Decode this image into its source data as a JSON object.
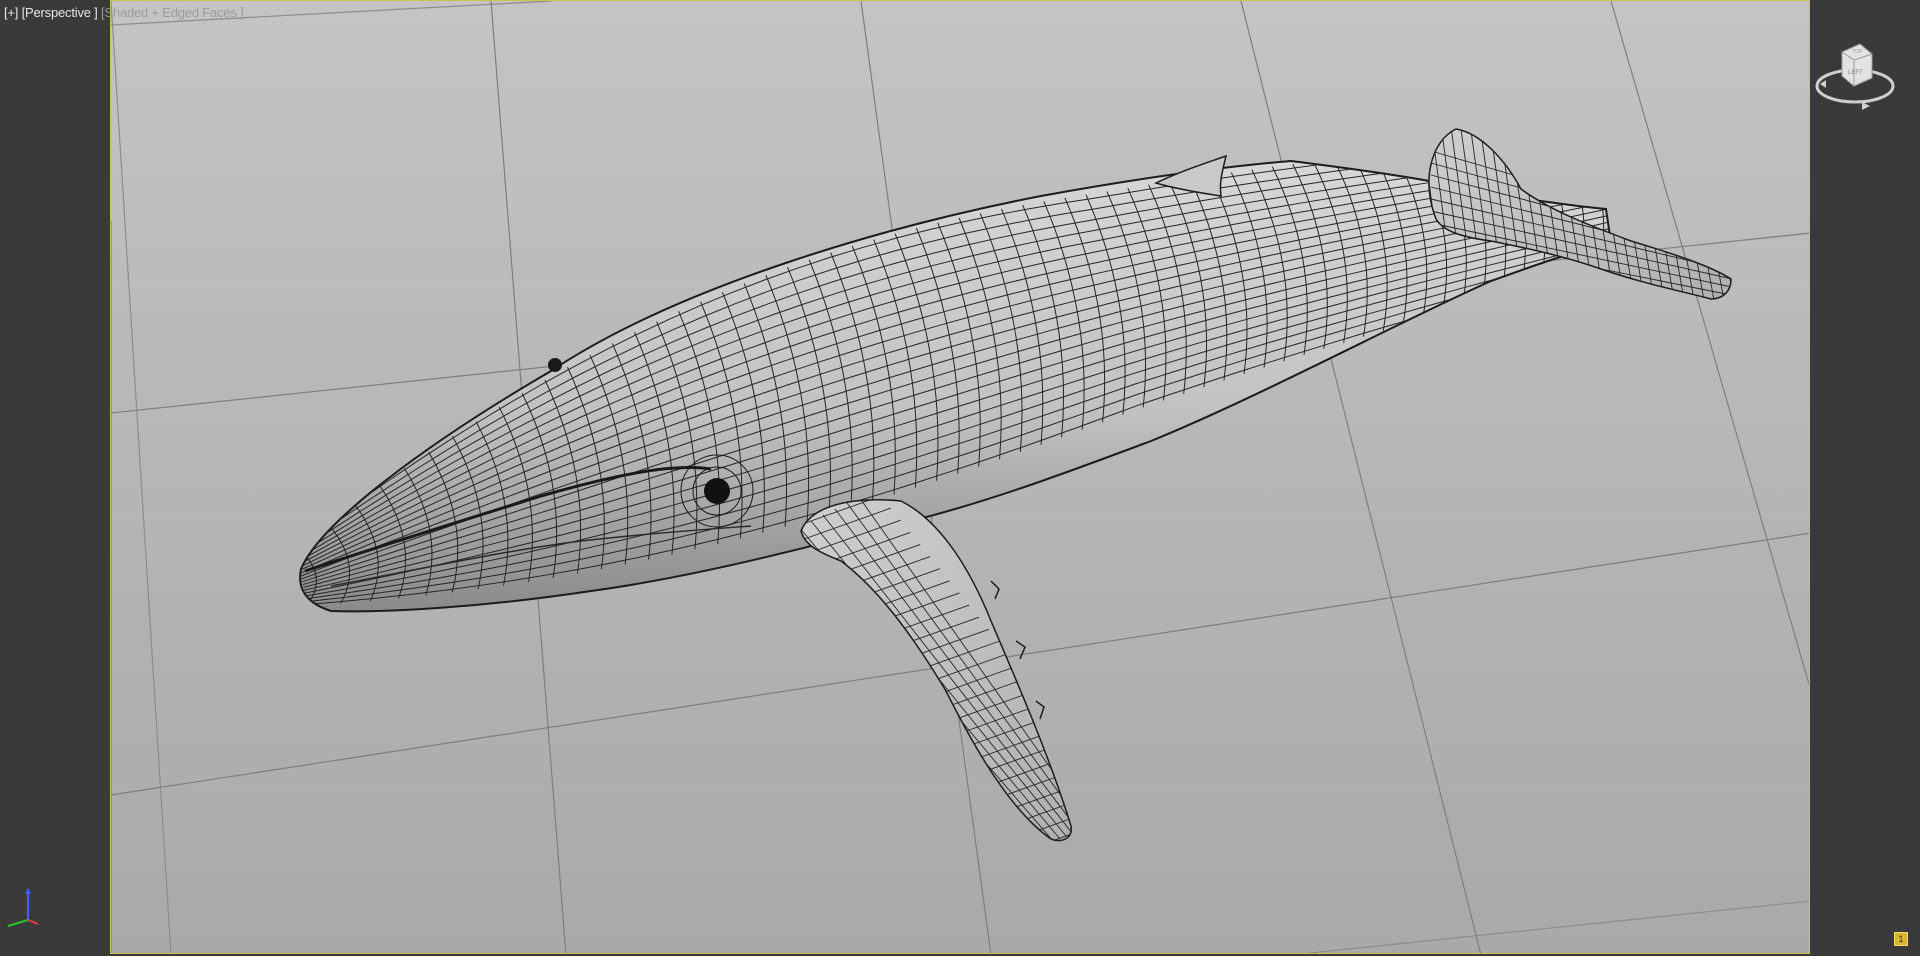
{
  "viewport": {
    "label_plus": "[+]",
    "label_view": "[Perspective ]",
    "label_shading": "[Shaded + Edged Faces ]"
  },
  "viewcube": {
    "face_label": "LEFT",
    "top_label": "TOP"
  },
  "status": {
    "corner_badge": "1"
  },
  "colors": {
    "viewport_border": "#c9c64a",
    "background_panel": "#3a3a3a",
    "viewport_bg": "#bdbdbd",
    "wire": "#1e1e1e"
  },
  "icons": {
    "viewcube": "viewcube-icon",
    "axis": "axis-tripod-icon"
  }
}
